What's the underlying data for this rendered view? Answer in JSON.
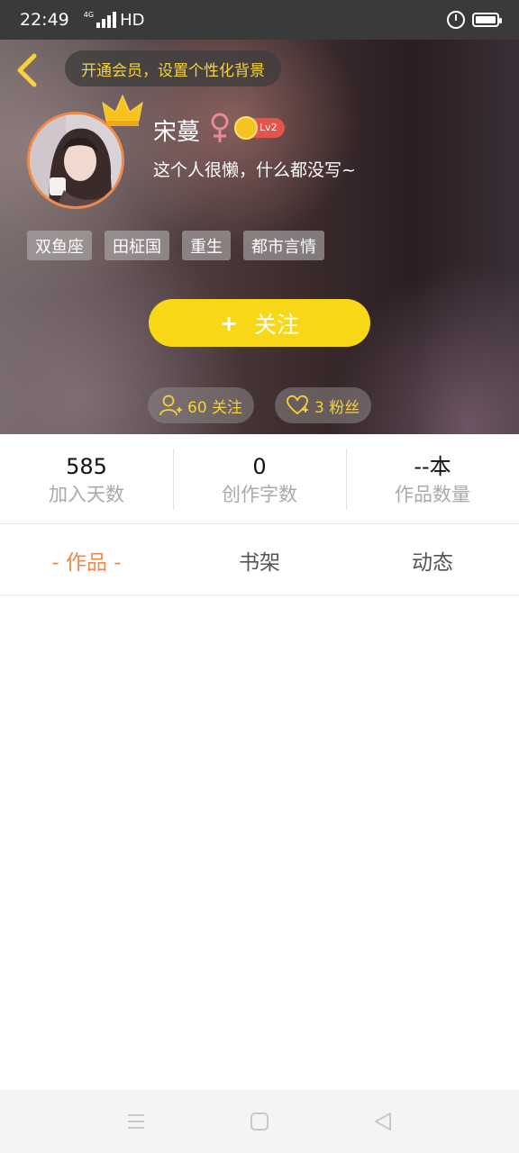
{
  "status_bar": {
    "time": "22:49",
    "network": "4G",
    "hd": "HD"
  },
  "header": {
    "vip_banner": "开通会员，设置个性化背景",
    "name": "宋蔓",
    "gender_symbol": "♀",
    "level": "Lv2",
    "bio": "这个人很懒，什么都没写~",
    "tags": [
      "双鱼座",
      "田柾国",
      "重生",
      "都市言情"
    ],
    "follow_label": "关注",
    "follow_plus": "+",
    "following_label": "60 关注",
    "fans_label": "3 粉丝"
  },
  "stats": [
    {
      "value": "585",
      "label": "加入天数"
    },
    {
      "value": "0",
      "label": "创作字数"
    },
    {
      "value": "--本",
      "label": "作品数量"
    }
  ],
  "tabs": [
    {
      "label": "- 作品 -",
      "active": true
    },
    {
      "label": "书架",
      "active": false
    },
    {
      "label": "动态",
      "active": false
    }
  ],
  "colors": {
    "accent": "#f08a4a",
    "follow_button": "#f7d716",
    "vip_text": "#f5d23a",
    "level_badge": "#e4544f"
  }
}
